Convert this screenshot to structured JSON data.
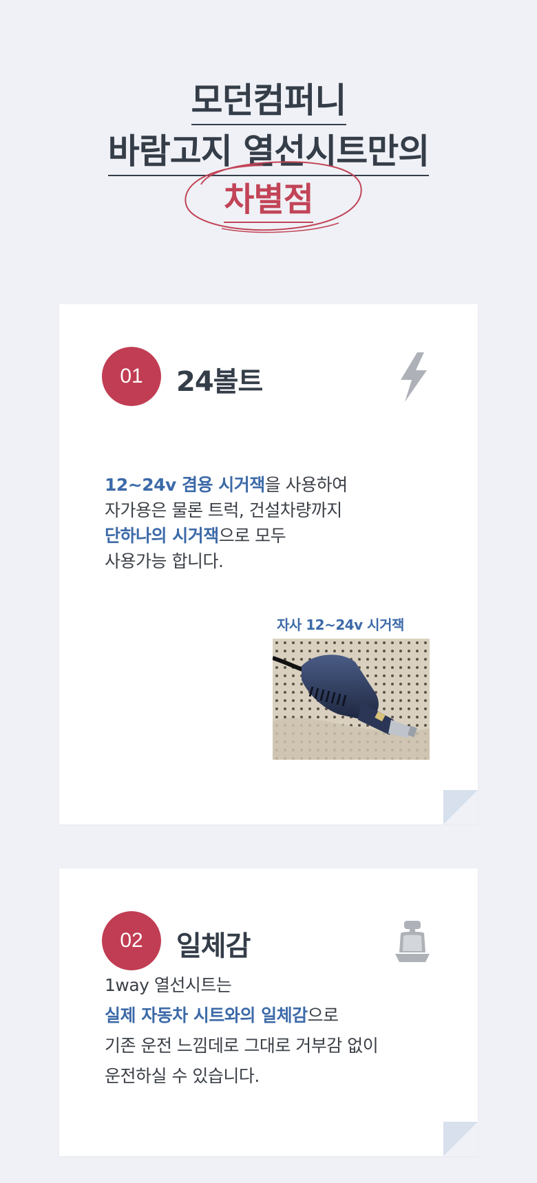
{
  "hero": {
    "line1": "모던컴퍼니",
    "line2": "바람고지 열선시트만의",
    "line3": "차별점"
  },
  "cards": [
    {
      "number": "01",
      "title": "24볼트",
      "icon": "lightning-icon",
      "body": {
        "l1_hl": "12~24v 겸용 시거잭",
        "l1_rest": "을 사용하여",
        "l2": "자가용은 물론 트럭, 건설차량까지",
        "l3_hl": "단하나의 시거잭",
        "l3_rest": "으로 모두",
        "l4": "사용가능 합니다."
      },
      "photo_caption": "자사 12~24v 시거잭"
    },
    {
      "number": "02",
      "title": "일체감",
      "icon": "car-seat-icon",
      "body": {
        "l1": "1way 열선시트는",
        "l2_hl": "실제 자동차 시트와의 일체감",
        "l2_rest": "으로",
        "l3": "기존 운전 느낌데로 그대로 거부감 없이",
        "l4": "운전하실 수 있습니다."
      }
    }
  ],
  "colors": {
    "background": "#eff1f6",
    "accent_red": "#c13d53",
    "highlight_blue": "#3c6aa8",
    "title_dark": "#343d48"
  }
}
